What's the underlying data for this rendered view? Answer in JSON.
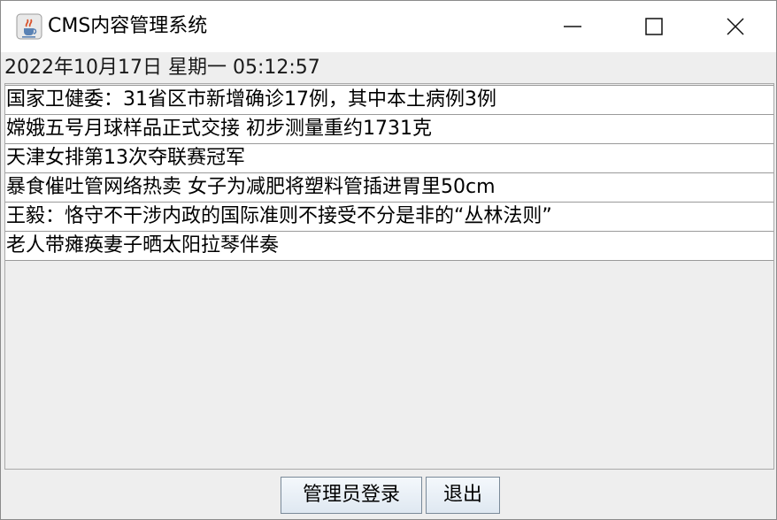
{
  "window": {
    "title": "CMS内容管理系统",
    "icon": "java-cup-icon",
    "controls": {
      "minimize": "minimize-icon",
      "maximize": "maximize-icon",
      "close": "close-icon"
    }
  },
  "clock": {
    "text": "2022年10月17日 星期一 05:12:57"
  },
  "news": {
    "items": [
      {
        "title": "国家卫健委：31省区市新增确诊17例，其中本土病例3例"
      },
      {
        "title": "嫦娥五号月球样品正式交接 初步测量重约1731克"
      },
      {
        "title": "天津女排第13次夺联赛冠军"
      },
      {
        "title": "暴食催吐管网络热卖 女子为减肥将塑料管插进胃里50cm"
      },
      {
        "title": "王毅：恪守不干涉内政的国际准则不接受不分是非的“丛林法则”"
      },
      {
        "title": "老人带瘫痪妻子晒太阳拉琴伴奏"
      }
    ]
  },
  "buttons": {
    "login_label": "管理员登录",
    "exit_label": "退出"
  }
}
